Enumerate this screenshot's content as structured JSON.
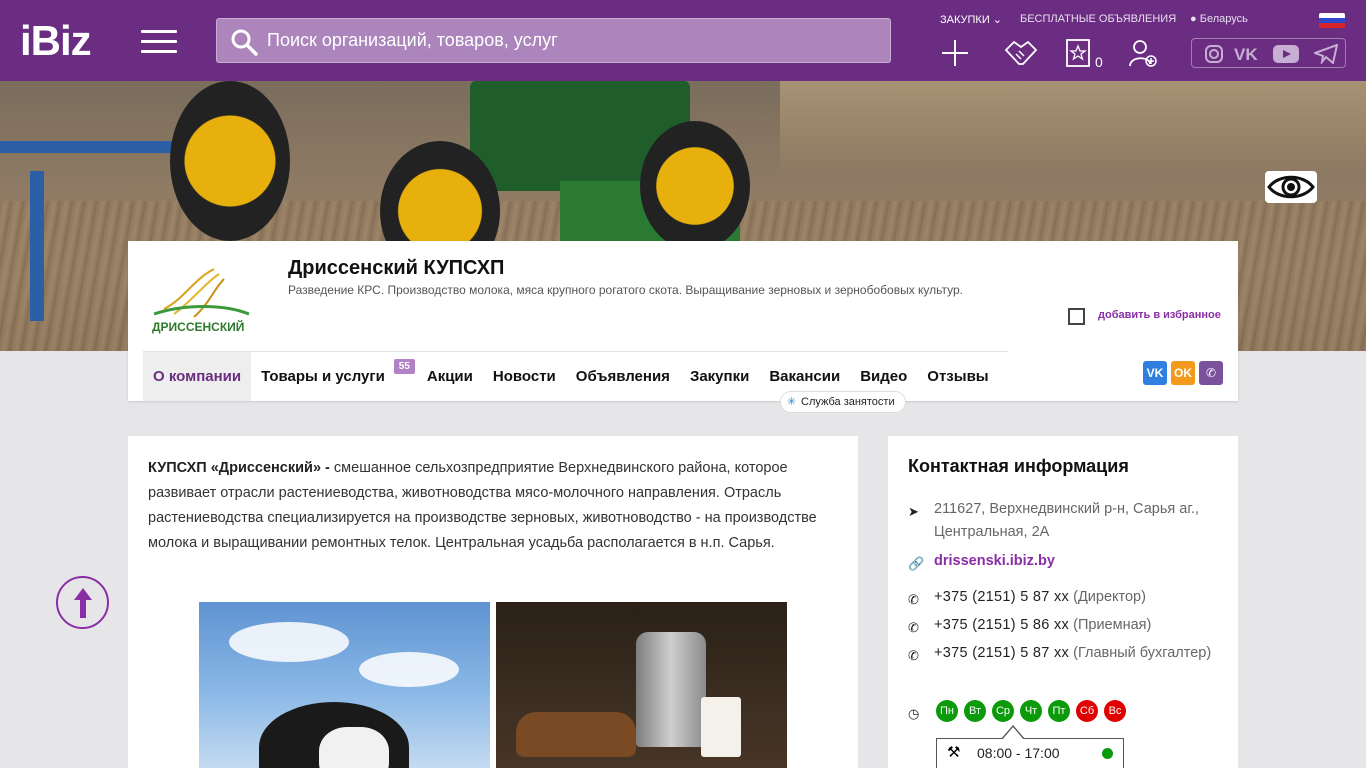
{
  "header": {
    "logo": "iBiz",
    "search_placeholder": "Поиск организаций, товаров, услуг",
    "links": {
      "zakupki": "ЗАКУПКИ",
      "free_ads": "БЕСПЛАТНЫЕ ОБЪЯВЛЕНИЯ",
      "location": "Беларусь"
    },
    "favorites_count": "0",
    "icons": [
      "plus-icon",
      "handshake-icon",
      "star-icon",
      "add-user-icon"
    ],
    "social": [
      "instagram-icon",
      "vk-icon",
      "youtube-icon",
      "telegram-icon"
    ]
  },
  "company": {
    "logo_text": "ДРИССЕНСКИЙ",
    "name": "Дриссенский КУПСХП",
    "description": "Разведение КРС. Производство молока, мяса крупного рогатого скота. Выращивание зерновых и зернобобовых культур.",
    "favorite_label": "добавить в избранное"
  },
  "nav": {
    "items": [
      {
        "label": "О компании"
      },
      {
        "label": "Товары и услуги",
        "badge": "55"
      },
      {
        "label": "Акции"
      },
      {
        "label": "Новости"
      },
      {
        "label": "Объявления"
      },
      {
        "label": "Закупки"
      },
      {
        "label": "Вакансии"
      },
      {
        "label": "Видео"
      },
      {
        "label": "Отзывы"
      }
    ],
    "sluzhba": "Служба занятости",
    "share": [
      {
        "label": "VK",
        "color": "#2f7fe0"
      },
      {
        "label": "OK",
        "color": "#f39a1c"
      },
      {
        "label": "Viber",
        "color": "#7b519d"
      }
    ]
  },
  "about": {
    "lead": "КУПСХП «Дриссенский» - ",
    "text": "смешанное сельхозпредприятие Верхнедвинского района, которое развивает отрасли растениеводства, животноводства мясо-молочного направления.  Отрасль растениеводства специализируется на производстве зерновых, животноводство - на производстве молока и выращивании ремонтных телок. Центральная усадьба располагается в н.п. Сарья."
  },
  "contacts": {
    "title": "Контактная информация",
    "address": "211627, Верхнедвинский р-н, Сарья аг., Центральная, 2А",
    "site": "drissenski.ibiz.by",
    "phones": [
      {
        "number": "+375 (2151) 5 87 xx",
        "note": "(Директор)"
      },
      {
        "number": "+375 (2151) 5 86 xx",
        "note": "(Приемная)"
      },
      {
        "number": "+375 (2151) 5 87 xx",
        "note": "(Главный бухгалтер)"
      }
    ],
    "days": [
      {
        "label": "Пн",
        "color": "#0a9a0a"
      },
      {
        "label": "Вт",
        "color": "#0a9a0a"
      },
      {
        "label": "Ср",
        "color": "#0a9a0a"
      },
      {
        "label": "Чт",
        "color": "#0a9a0a"
      },
      {
        "label": "Пт",
        "color": "#0a9a0a"
      },
      {
        "label": "Сб",
        "color": "#e00000"
      },
      {
        "label": "Вс",
        "color": "#e00000"
      }
    ],
    "hours": "08:00 - 17:00"
  },
  "colors": {
    "brand": "#6b2d82",
    "accent": "#8a2ea6"
  }
}
